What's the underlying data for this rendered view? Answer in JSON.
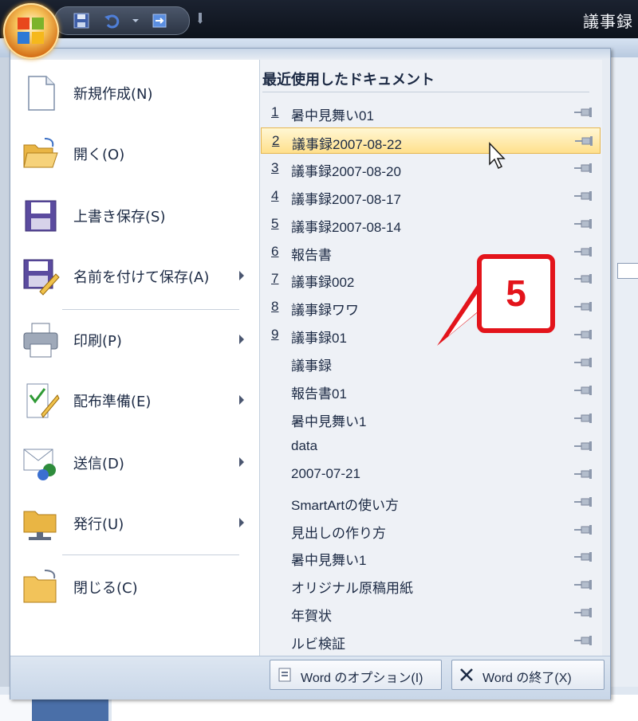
{
  "window": {
    "title": "議事録"
  },
  "menu": {
    "commands": [
      {
        "label": "新規作成(N)",
        "icon": "new-document-icon",
        "submenu": false
      },
      {
        "label": "開く(O)",
        "icon": "open-folder-icon",
        "submenu": false
      },
      {
        "label": "上書き保存(S)",
        "icon": "save-icon",
        "submenu": false
      },
      {
        "label": "名前を付けて保存(A)",
        "icon": "save-as-icon",
        "submenu": true
      },
      {
        "label": "印刷(P)",
        "icon": "print-icon",
        "submenu": true
      },
      {
        "label": "配布準備(E)",
        "icon": "prepare-icon",
        "submenu": true
      },
      {
        "label": "送信(D)",
        "icon": "send-icon",
        "submenu": true
      },
      {
        "label": "発行(U)",
        "icon": "publish-icon",
        "submenu": true
      },
      {
        "label": "閉じる(C)",
        "icon": "close-folder-icon",
        "submenu": false
      }
    ],
    "recent": {
      "title": "最近使用したドキュメント",
      "items": [
        {
          "num": "1",
          "name": "暑中見舞い01"
        },
        {
          "num": "2",
          "name": "議事録2007-08-22",
          "highlighted": true
        },
        {
          "num": "3",
          "name": "議事録2007-08-20"
        },
        {
          "num": "4",
          "name": "議事録2007-08-17"
        },
        {
          "num": "5",
          "name": "議事録2007-08-14"
        },
        {
          "num": "6",
          "name": "報告書"
        },
        {
          "num": "7",
          "name": "議事録002"
        },
        {
          "num": "8",
          "name": "議事録ワワ"
        },
        {
          "num": "9",
          "name": "議事録01"
        },
        {
          "num": "",
          "name": "議事録"
        },
        {
          "num": "",
          "name": "報告書01"
        },
        {
          "num": "",
          "name": "暑中見舞い1"
        },
        {
          "num": "",
          "name": "data"
        },
        {
          "num": "",
          "name": "2007-07-21"
        },
        {
          "num": "",
          "name": "SmartArtの使い方"
        },
        {
          "num": "",
          "name": "見出しの作り方"
        },
        {
          "num": "",
          "name": "暑中見舞い1"
        },
        {
          "num": "",
          "name": "オリジナル原稿用紙"
        },
        {
          "num": "",
          "name": "年賀状"
        },
        {
          "num": "",
          "name": "ルビ検証"
        }
      ]
    },
    "buttons": {
      "options_label": "Word のオプション(I)",
      "exit_label": "Word の終了(X)"
    }
  },
  "callout": {
    "number": "5",
    "color": "#e3141b"
  },
  "colors": {
    "highlight": "#ffe08c",
    "accent": "#e3141b"
  }
}
